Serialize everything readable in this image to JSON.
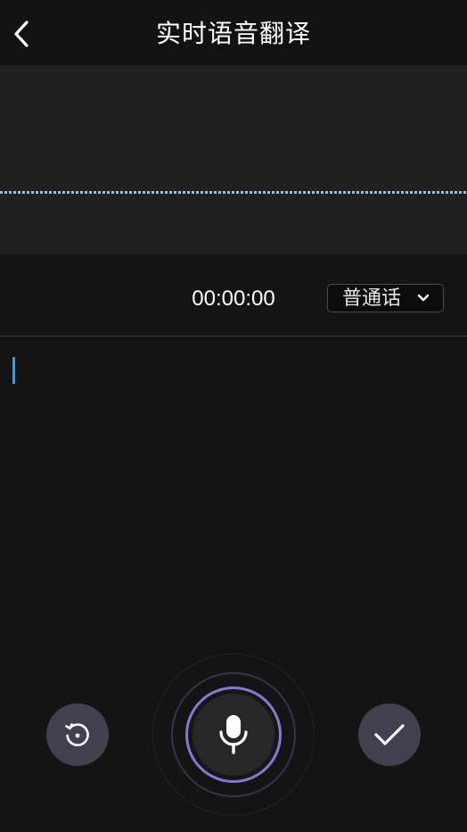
{
  "header": {
    "title": "实时语音翻译",
    "back_icon": "chevron-left-icon"
  },
  "waveform": {
    "line_color": "#8fc6ec"
  },
  "recorder": {
    "timer": "00:00:00",
    "language": {
      "selected": "普通话",
      "icon": "chevron-down-icon"
    }
  },
  "transcript": {
    "value": "",
    "caret_color": "#3b9be8"
  },
  "controls": {
    "reset_icon": "rotate-ccw-icon",
    "mic_icon": "microphone-icon",
    "confirm_icon": "check-icon",
    "accent_color": "#8a74d6"
  }
}
